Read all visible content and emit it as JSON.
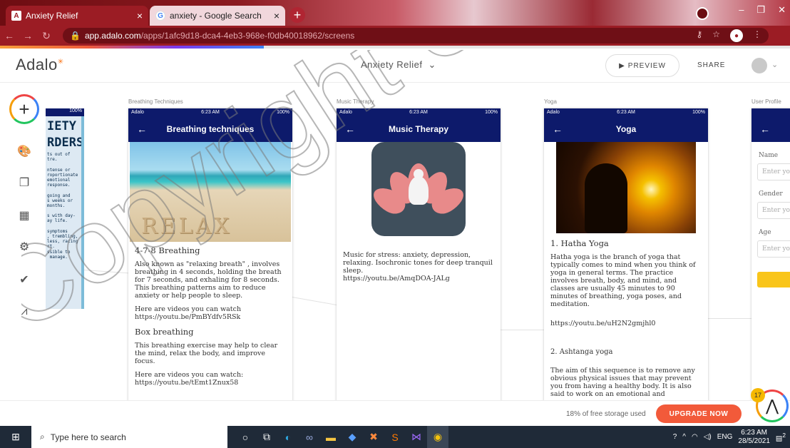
{
  "browser": {
    "tabs": [
      {
        "label": "Anxiety Relief",
        "active": true
      },
      {
        "label": "anxiety - Google Search",
        "active": false
      }
    ],
    "url_domain": "app.adalo.com",
    "url_path": "/apps/1afc9d18-dca4-4eb3-968e-f0db40018962/screens"
  },
  "header": {
    "logo": "Adalo",
    "app_name": "Anxiety Relief",
    "preview_label": "PREVIEW",
    "share_label": "SHARE"
  },
  "screens": {
    "left_partial": {
      "status_battery": "100%",
      "poster_big_1": "IETY",
      "poster_big_2": "RDERS",
      "poster_lines": "ts out of\ntre.\n\nntense or\nroportionate\nemotional\nresponse.\n\ngoing and\ns weeks or\nmonths.\n\ns with day-\nay life.\n\nsymptoms\n, trembling,\nless, racing\nrt.\nssible to\n manage."
    },
    "breathing": {
      "label": "Breathing Techniques",
      "carrier": "Adalo",
      "time": "6:23 AM",
      "battery": "100%",
      "title": "Breathing techniques",
      "image_word": "RELAX",
      "h1": "4-7-8 Breathing",
      "p1": "Also known as \"relaxing breath\" , involves breathing in 4 seconds, holding the breath for 7 seconds, and exhaling for 8 seconds. This breathing patterns aim to reduce anxiety or help people to sleep.",
      "p2": "Here are videos you can watch https://youtu.be/PmBYdfv5RSk",
      "h2": "Box breathing",
      "p3": "This breathing exercise may help to clear the mind, relax the body, and improve focus.",
      "p4": "Here are videos you can watch: https://youtu.be/tEmt1Znux58"
    },
    "music": {
      "label": "Music Therapy",
      "carrier": "Adalo",
      "time": "6:23 AM",
      "battery": "100%",
      "title": "Music Therapy",
      "p1": "Music for stress: anxiety, depression, relaxing. Isochronic tones for deep tranquil sleep.",
      "link": "https://youtu.be/AmqDOA-JALg"
    },
    "yoga": {
      "label": "Yoga",
      "carrier": "Adalo",
      "time": "6:23 AM",
      "battery": "100%",
      "title": "Yoga",
      "h1": "1. Hatha Yoga",
      "p1": "Hatha yoga is the branch of yoga that typically comes to mind when you think of yoga in general terms. The practice involves breath, body, and mind, and classes are usually 45 minutes to 90 minutes of breathing, yoga poses, and meditation.",
      "link1": "https://youtu.be/uH2N2gmjhl0",
      "h2": "2. Ashtanga yoga",
      "p2": "The aim of this sequence is to remove any obvious physical issues that may prevent you from having a healthy body. It is also said to work on an emotional and"
    },
    "profile": {
      "label": "User Profile",
      "fields": [
        {
          "label": "Name",
          "placeholder": "Enter yo"
        },
        {
          "label": "Gender",
          "placeholder": "Enter yo"
        },
        {
          "label": "Age",
          "placeholder": "Enter yo"
        }
      ]
    }
  },
  "footer": {
    "storage": "18% of free storage used",
    "upgrade_label": "UPGRADE NOW",
    "help_count": "17"
  },
  "taskbar": {
    "search_placeholder": "Type here to search",
    "lang": "ENG",
    "time": "6:23 AM",
    "date": "28/5/2021",
    "notif_count": "2"
  },
  "watermark": "Copyright UiTM"
}
